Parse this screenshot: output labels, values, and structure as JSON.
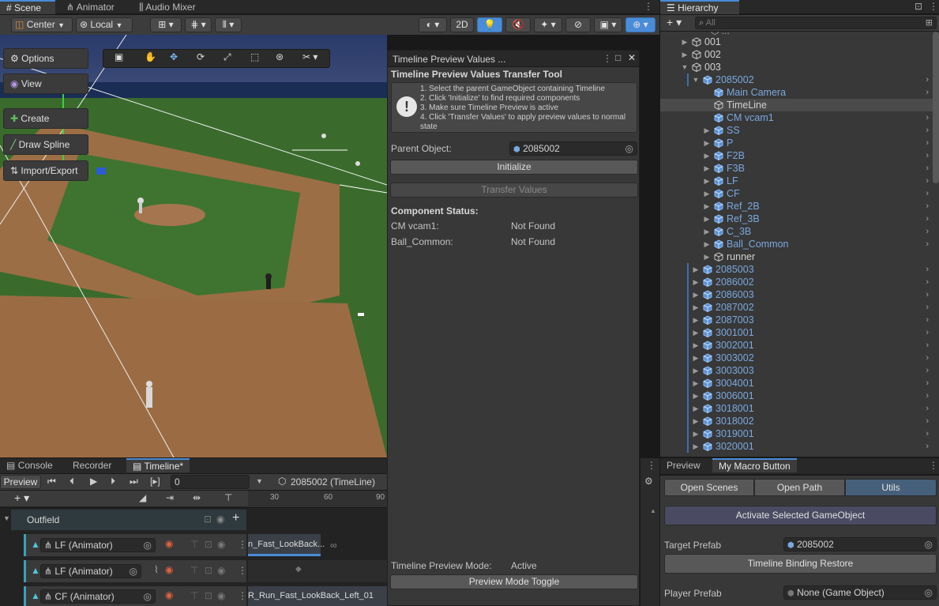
{
  "scene_panel": {
    "tabs": [
      {
        "label": "Scene",
        "icon": "grid-icon"
      },
      {
        "label": "Animator",
        "icon": "animator-icon"
      },
      {
        "label": "Audio Mixer",
        "icon": "mixer-icon"
      }
    ],
    "pivot": "Center",
    "space": "Local",
    "mode_2d": "2D",
    "overlay_buttons": [
      "Options",
      "View",
      "Create",
      "Draw Spline",
      "Import/Export"
    ]
  },
  "preview_window": {
    "title": "Timeline Preview Values ...",
    "heading": "Timeline Preview Values Transfer Tool",
    "steps": [
      "1. Select the parent GameObject containing Timeline",
      "2. Click 'Initialize' to find required components",
      "3. Make sure Timeline Preview is active",
      "4. Click 'Transfer Values' to apply preview values to normal state"
    ],
    "parent_label": "Parent Object:",
    "parent_value": "2085002",
    "initialize_label": "Initialize",
    "transfer_label": "Transfer Values",
    "status_heading": "Component Status:",
    "status": [
      {
        "name": "CM vcam1:",
        "value": "Not Found"
      },
      {
        "name": "Ball_Common:",
        "value": "Not Found"
      }
    ],
    "mode_label": "Timeline Preview Mode:",
    "mode_value": "Active",
    "toggle_label": "Preview Mode Toggle"
  },
  "bottom_panel": {
    "tabs": [
      "Console",
      "Recorder",
      "Timeline*"
    ],
    "preview_label": "Preview",
    "frame_value": "0",
    "binding": "2085002 (TimeLine)",
    "ruler": [
      "30",
      "60",
      "90"
    ],
    "group": "Outfield",
    "tracks": [
      {
        "name": "LF (Animator)",
        "clip": "n_Fast_LookBack..."
      },
      {
        "name": "LF (Animator)",
        "clip": ""
      },
      {
        "name": "CF (Animator)",
        "clip": "R_Run_Fast_LookBack_Left_01"
      }
    ]
  },
  "hierarchy": {
    "title": "Hierarchy",
    "search_placeholder": "All",
    "rows": [
      {
        "label": "001",
        "depth": 3,
        "fold": "right",
        "kind": "white"
      },
      {
        "label": "002",
        "depth": 3,
        "fold": "right",
        "kind": "white"
      },
      {
        "label": "003",
        "depth": 3,
        "fold": "down",
        "kind": "white"
      },
      {
        "label": "2085002",
        "depth": 4,
        "fold": "down",
        "kind": "blue"
      },
      {
        "label": "Main Camera",
        "depth": 5,
        "fold": "",
        "kind": "blue"
      },
      {
        "label": "TimeLine",
        "depth": 5,
        "fold": "",
        "kind": "white"
      },
      {
        "label": "CM vcam1",
        "depth": 5,
        "fold": "",
        "kind": "blue"
      },
      {
        "label": "SS",
        "depth": 5,
        "fold": "right",
        "kind": "blue"
      },
      {
        "label": "P",
        "depth": 5,
        "fold": "right",
        "kind": "blue"
      },
      {
        "label": "F2B",
        "depth": 5,
        "fold": "right",
        "kind": "blue"
      },
      {
        "label": "F3B",
        "depth": 5,
        "fold": "right",
        "kind": "blue"
      },
      {
        "label": "LF",
        "depth": 5,
        "fold": "right",
        "kind": "blue"
      },
      {
        "label": "CF",
        "depth": 5,
        "fold": "right",
        "kind": "blue"
      },
      {
        "label": "Ref_2B",
        "depth": 5,
        "fold": "right",
        "kind": "blue"
      },
      {
        "label": "Ref_3B",
        "depth": 5,
        "fold": "right",
        "kind": "blue"
      },
      {
        "label": "C_3B",
        "depth": 5,
        "fold": "right",
        "kind": "blue"
      },
      {
        "label": "Ball_Common",
        "depth": 5,
        "fold": "right",
        "kind": "blue"
      },
      {
        "label": "runner",
        "depth": 5,
        "fold": "right",
        "kind": "white"
      },
      {
        "label": "2085003",
        "depth": 4,
        "fold": "right",
        "kind": "blue"
      },
      {
        "label": "2086002",
        "depth": 4,
        "fold": "right",
        "kind": "blue"
      },
      {
        "label": "2086003",
        "depth": 4,
        "fold": "right",
        "kind": "blue"
      },
      {
        "label": "2087002",
        "depth": 4,
        "fold": "right",
        "kind": "blue"
      },
      {
        "label": "2087003",
        "depth": 4,
        "fold": "right",
        "kind": "blue"
      },
      {
        "label": "3001001",
        "depth": 4,
        "fold": "right",
        "kind": "blue"
      },
      {
        "label": "3002001",
        "depth": 4,
        "fold": "right",
        "kind": "blue"
      },
      {
        "label": "3003002",
        "depth": 4,
        "fold": "right",
        "kind": "blue"
      },
      {
        "label": "3003003",
        "depth": 4,
        "fold": "right",
        "kind": "blue"
      },
      {
        "label": "3004001",
        "depth": 4,
        "fold": "right",
        "kind": "blue"
      },
      {
        "label": "3006001",
        "depth": 4,
        "fold": "right",
        "kind": "blue"
      },
      {
        "label": "3018001",
        "depth": 4,
        "fold": "right",
        "kind": "blue"
      },
      {
        "label": "3018002",
        "depth": 4,
        "fold": "right",
        "kind": "blue"
      },
      {
        "label": "3019001",
        "depth": 4,
        "fold": "right",
        "kind": "blue"
      },
      {
        "label": "3020001",
        "depth": 4,
        "fold": "right",
        "kind": "blue"
      }
    ],
    "selected_label": "TimeLine"
  },
  "macro_panel": {
    "tabs": [
      "Preview",
      "My Macro Button"
    ],
    "mode_buttons": [
      "Open Scenes",
      "Open Path",
      "Utils"
    ],
    "activate_label": "Activate Selected GameObject",
    "target_label": "Target Prefab",
    "target_value": "2085002",
    "restore_label": "Timeline Binding Restore",
    "player_label": "Player Prefab",
    "player_value": "None (Game Object)"
  },
  "colors": {
    "accent": "#4a8cd8",
    "blue_item": "#7ba7de",
    "panel": "#383838",
    "field": "#2a2a2a"
  }
}
